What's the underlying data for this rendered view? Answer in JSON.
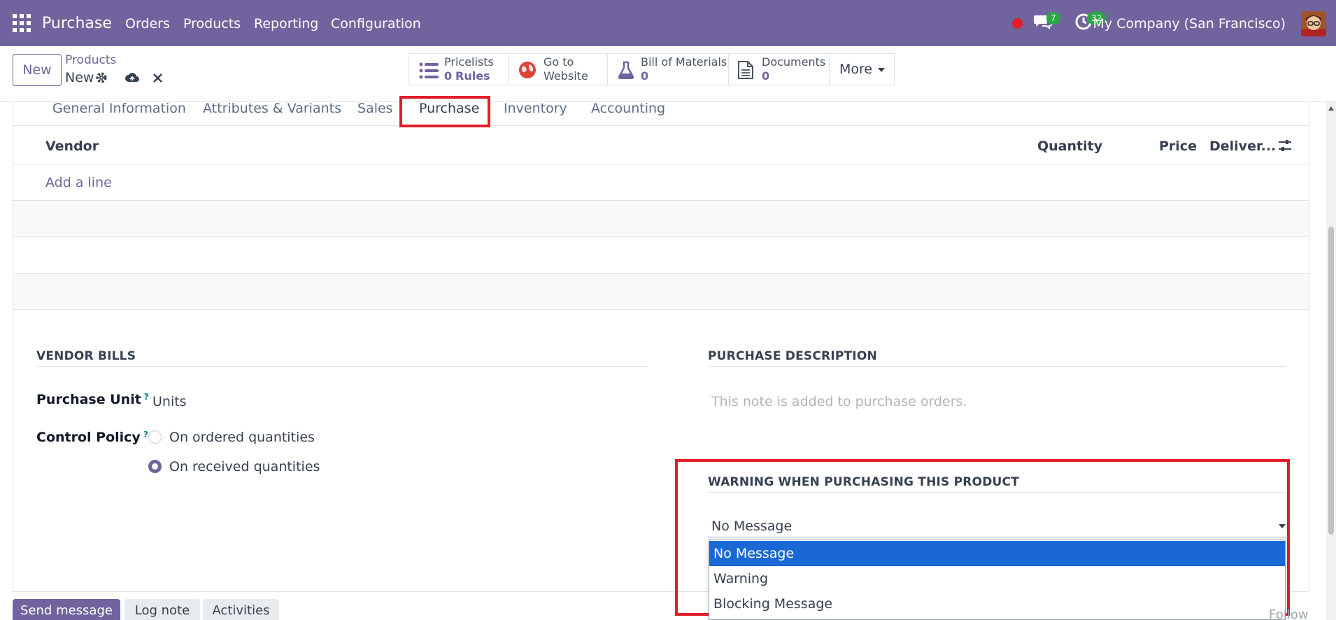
{
  "navbar": {
    "app_name": "Purchase",
    "menu": [
      "Orders",
      "Products",
      "Reporting",
      "Configuration"
    ],
    "messages_count": "7",
    "activities_count": "32",
    "company": "My Company (San Francisco)"
  },
  "control_panel": {
    "new_label": "New",
    "breadcrumb_parent": "Products",
    "breadcrumb_current": "New"
  },
  "smart_buttons": [
    {
      "label": "Pricelists",
      "value": "0",
      "value_suffix": "Rules",
      "icon": "list-icon"
    },
    {
      "label": "Go to",
      "label2": "Website",
      "icon": "globe-icon"
    },
    {
      "label": "Bill of Materials",
      "value": "0",
      "icon": "flask-icon"
    },
    {
      "label": "Documents",
      "value": "0",
      "icon": "document-icon"
    },
    {
      "label": "More",
      "icon": "caret-down-icon"
    }
  ],
  "tabs": [
    "General Information",
    "Attributes & Variants",
    "Sales",
    "Purchase",
    "Inventory",
    "Accounting"
  ],
  "active_tab": "Purchase",
  "vendor_table": {
    "columns": [
      "Vendor",
      "Quantity",
      "Price",
      "Deliver..."
    ],
    "add_line": "Add a line"
  },
  "vendor_bills": {
    "title": "VENDOR BILLS",
    "purchase_unit_label": "Purchase Unit",
    "purchase_unit_help": "?",
    "purchase_unit_value": "Units",
    "control_policy_label": "Control Policy",
    "control_policy_help": "?",
    "control_policy_options": [
      "On ordered quantities",
      "On received quantities"
    ],
    "control_policy_selected": "On received quantities"
  },
  "purchase_description": {
    "title": "PURCHASE DESCRIPTION",
    "placeholder": "This note is added to purchase orders."
  },
  "purchase_warning": {
    "title": "WARNING WHEN PURCHASING THIS PRODUCT",
    "selected": "No Message",
    "options": [
      "No Message",
      "Warning",
      "Blocking Message"
    ]
  },
  "chatter": {
    "send_message": "Send message",
    "log_note": "Log note",
    "activities": "Activities",
    "follow": "Follow"
  },
  "colors": {
    "brand": "#71639e",
    "highlight_box": "#e11d2a",
    "dropdown_selected": "#1a68d4",
    "badge": "#28a745"
  }
}
